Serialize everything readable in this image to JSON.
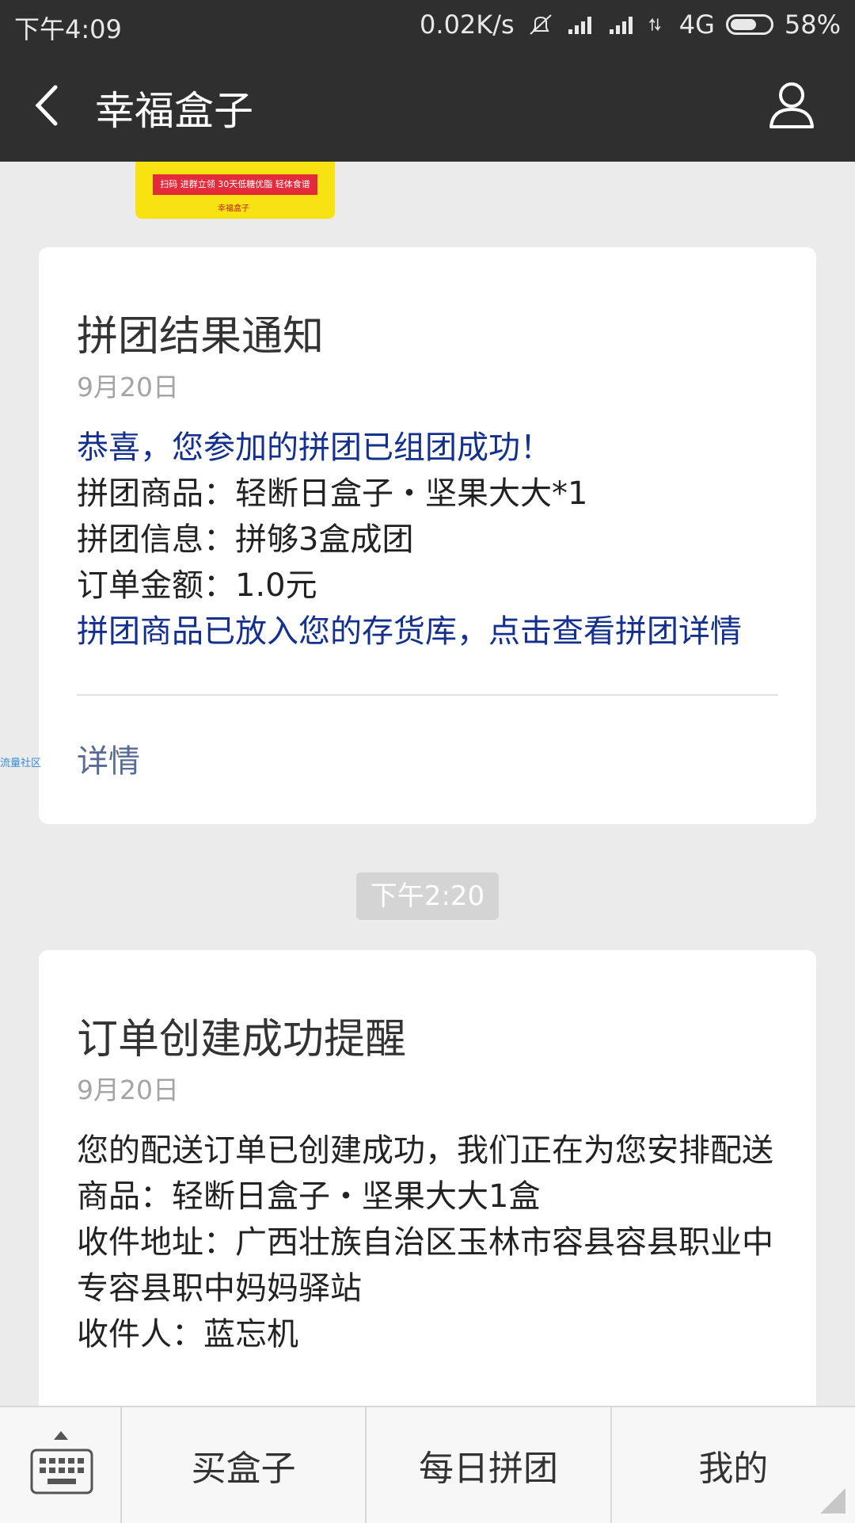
{
  "status_bar": {
    "time": "下午4:09",
    "net_speed": "0.02K/s",
    "network": "4G",
    "battery": "58%"
  },
  "header": {
    "title": "幸福盒子",
    "back_icon": "chevron-left-icon",
    "user_icon": "person-icon"
  },
  "banner": {
    "strip_text": "扫码 进群立领 30天低糖优脂 轻体食谱",
    "logo_text": "幸福盒子"
  },
  "card1": {
    "title": "拼团结果通知",
    "date": "9月20日",
    "lines": [
      "恭喜，您参加的拼团已组团成功！",
      "拼团商品：轻断日盒子・坚果大大*1",
      "拼团信息：拼够3盒成团",
      "订单金额：1.0元",
      "拼团商品已放入您的存货库，点击查看拼团详情"
    ],
    "link": "详情"
  },
  "side_mark": "流量社区",
  "time_badge": "下午2:20",
  "card2": {
    "title": "订单创建成功提醒",
    "date": "9月20日",
    "lines": [
      "您的配送订单已创建成功，我们正在为您安排配送",
      "商品：轻断日盒子・坚果大大1盒",
      "收件地址：广西壮族自治区玉林市容县容县职业中专容县职中妈妈驿站",
      "收件人：蓝忘机"
    ]
  },
  "bottom_menu": {
    "keyboard_icon": "keyboard-icon",
    "items": [
      "买盒子",
      "每日拼团",
      "我的"
    ]
  },
  "colors": {
    "header_bg": "#2f2f2f",
    "highlight_text": "#14308e",
    "link": "#576b95"
  }
}
